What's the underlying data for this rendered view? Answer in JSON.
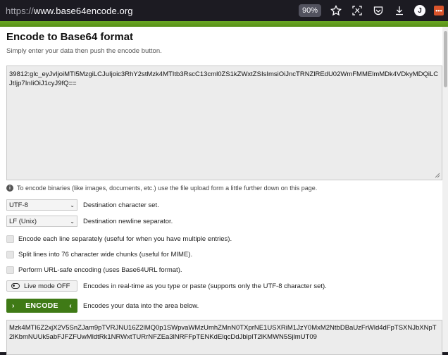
{
  "browser": {
    "url_prefix": "https://",
    "url_host": "www.base64encode.org",
    "zoom": "90%",
    "avatar_letter": "J",
    "extension_glyph": "•••"
  },
  "page": {
    "title": "Encode to Base64 format",
    "subtitle": "Simply enter your data then push the encode button.",
    "input_value": "39812:glc_eyJvIjoiMTI5MzgiLCJuIjoic3RhY2stMzk4MTItb3RscC13cml0ZS1kZWxtZSIsImsiOiJncTRNZlREdU02WmFMMElmMDk4VDkyMDQiLCJtIjp7InIiOiJ1cyJ9fQ==",
    "binary_note": "To encode binaries (like images, documents, etc.) use the file upload form a little further down on this page.",
    "charset_value": "UTF-8",
    "charset_label": "Destination character set.",
    "newline_value": "LF (Unix)",
    "newline_label": "Destination newline separator.",
    "each_line_label": "Encode each line separately (useful for when you have multiple entries).",
    "split_lines_label": "Split lines into 76 character wide chunks (useful for MIME).",
    "url_safe_label": "Perform URL-safe encoding (uses Base64URL format).",
    "live_mode_label": "Live mode OFF",
    "live_mode_desc": "Encodes in real-time as you type or paste (supports only the UTF-8 character set).",
    "encode_label": "ENCODE",
    "encode_desc": "Encodes your data into the area below.",
    "output_value": "Mzk4MTI6Z2xjX2V5SnZJam9pTVRJNU16Z2lMQ0p1SWpvaWMzUmhZMnN0TXprNE1USXRiM1JzY0MxM2NtbDBaUzFrWld4dFpTSXNJbXNpT2lKbmNUUk5abFJFZFUwMldtRk1NRWxtTURrNFZEa3lNRFFpTENKdElqcDdJblpIT2lKMWN5SjlmUT09"
  },
  "colors": {
    "brand_green": "#5f9b1c",
    "button_green": "#3f7a16"
  }
}
